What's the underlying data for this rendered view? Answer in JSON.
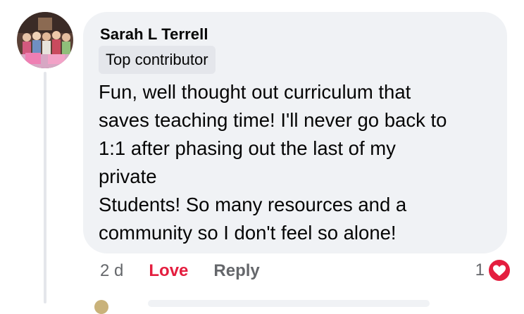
{
  "comment": {
    "author": "Sarah L Terrell",
    "badge": "Top contributor",
    "text_lines": [
      "Fun, well thought out curriculum that",
      "saves teaching time! I'll never go back to",
      "1:1 after phasing out the last of my",
      "private",
      "Students! So many resources and a",
      "community so I don't feel so alone!"
    ],
    "timestamp": "2 d",
    "love_label": "Love",
    "reply_label": "Reply",
    "reaction_count": "1",
    "reaction_icon": "love-heart-icon"
  },
  "colors": {
    "bubble": "#f0f2f5",
    "badge": "#e4e6eb",
    "love": "#e41e3f",
    "muted": "#65676b",
    "text": "#050505"
  }
}
